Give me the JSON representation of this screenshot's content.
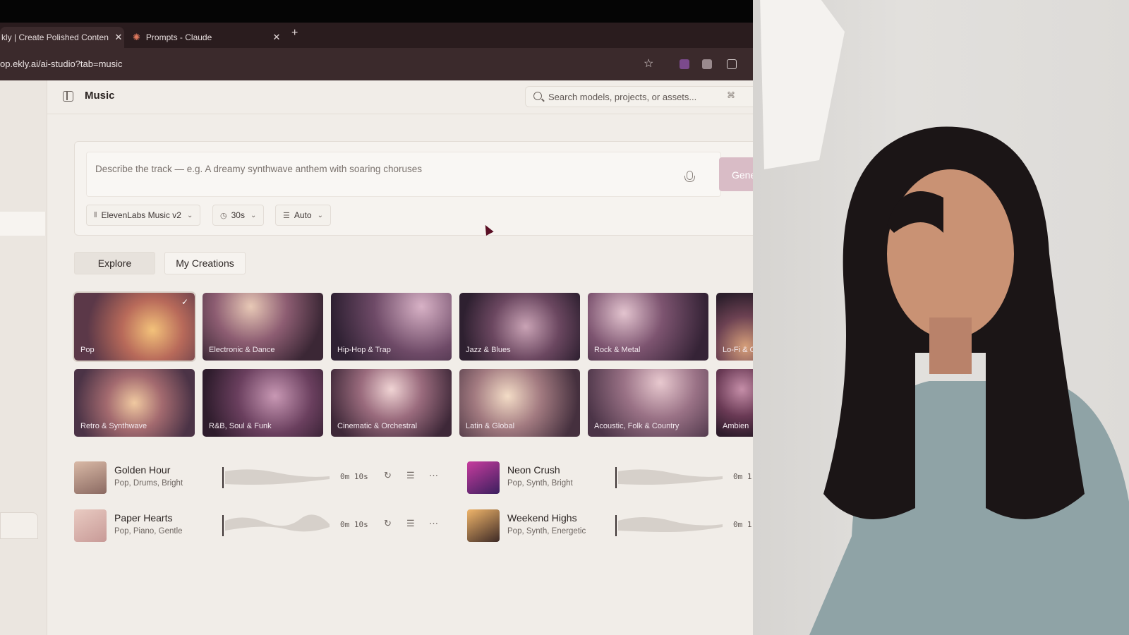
{
  "browser": {
    "tabs": [
      {
        "title": "kly | Create Polished Conten",
        "active": true
      },
      {
        "title": "Prompts - Claude",
        "active": false
      }
    ],
    "url": "op.ekly.ai/ai-studio?tab=music"
  },
  "header": {
    "title": "Music",
    "search_placeholder": "Search models, projects, or assets...",
    "search_shortcut": "⌘"
  },
  "composer": {
    "placeholder": "Describe the track — e.g. A dreamy synthwave anthem with soaring choruses",
    "generate_label": "Gene",
    "model": "ElevenLabs Music v2",
    "duration": "30s",
    "mode": "Auto"
  },
  "section_tabs": {
    "explore": "Explore",
    "mine": "My Creations"
  },
  "genres": [
    {
      "label": "Pop",
      "selected": true
    },
    {
      "label": "Electronic & Dance"
    },
    {
      "label": "Hip-Hop & Trap"
    },
    {
      "label": "Jazz & Blues"
    },
    {
      "label": "Rock & Metal"
    },
    {
      "label": "Lo-Fi & C"
    },
    {
      "label": "Retro & Synthwave"
    },
    {
      "label": "R&B, Soul & Funk"
    },
    {
      "label": "Cinematic & Orchestral"
    },
    {
      "label": "Latin & Global"
    },
    {
      "label": "Acoustic, Folk & Country"
    },
    {
      "label": "Ambien"
    }
  ],
  "tracks": [
    {
      "name": "Golden Hour",
      "tags": "Pop, Drums, Bright",
      "duration": "0m 10s"
    },
    {
      "name": "Neon Crush",
      "tags": "Pop, Synth, Bright",
      "duration": "0m 1"
    },
    {
      "name": "Paper Hearts",
      "tags": "Pop, Piano, Gentle",
      "duration": "0m 10s"
    },
    {
      "name": "Weekend Highs",
      "tags": "Pop, Synth, Energetic",
      "duration": "0m 1"
    }
  ],
  "colors": {
    "accent": "#d9bcc6",
    "background": "#f1ede8",
    "chrome": "#3b2a2c"
  }
}
